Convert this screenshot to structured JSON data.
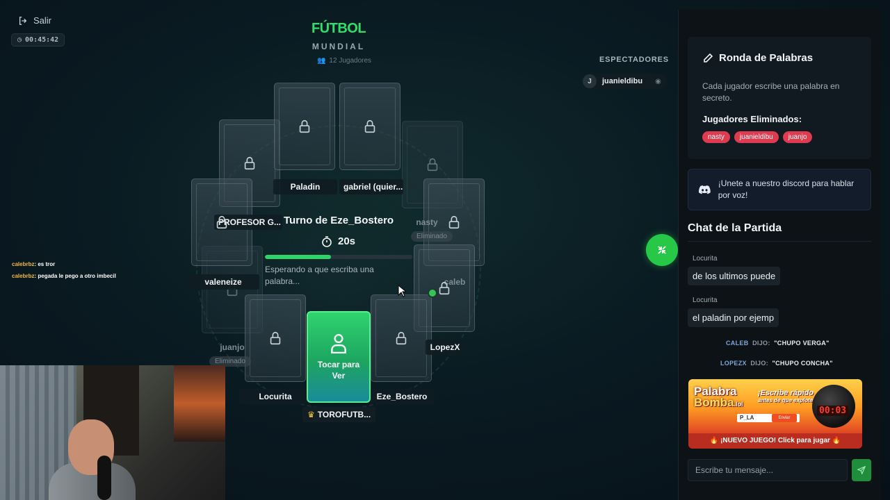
{
  "header": {
    "exit_label": "Salir",
    "session_timer": "00:45:42",
    "game_title": "FÚTBOL",
    "game_subtitle": "MUNDIAL",
    "players_count": "12 Jugadores"
  },
  "board": {
    "players": [
      {
        "name": "Paladin",
        "eliminated": false
      },
      {
        "name": "gabriel (quier...",
        "eliminated": false
      },
      {
        "name": "PROFESOR G...",
        "eliminated": false
      },
      {
        "name": "nasty",
        "eliminated": true
      },
      {
        "name": "valeneize",
        "eliminated": false
      },
      {
        "name": "caleb",
        "eliminated": false
      },
      {
        "name": "juanjo",
        "eliminated": true
      },
      {
        "name": "LopezX",
        "eliminated": false
      },
      {
        "name": "Locurita",
        "eliminated": false
      },
      {
        "name": "Eze_Bostero",
        "eliminated": false
      }
    ],
    "eliminated_label": "Eliminado",
    "center_card_label": "Tocar para Ver",
    "host_name": "TOROFUTB...",
    "turn_text": "Turno de Eze_Bostero",
    "turn_timer": "20s",
    "turn_progress": 0.45,
    "waiting_text": "Esperando a que escriba una palabra..."
  },
  "spectators": {
    "title": "ESPECTADORES",
    "items": [
      {
        "initial": "J",
        "name": "juanieldibu"
      }
    ]
  },
  "stream_chat": [
    {
      "user": "calebrbz",
      "text": ": es tror"
    },
    {
      "user": "calebrbz",
      "text": ": pegada le pego a otro imbecil"
    }
  ],
  "round": {
    "title": "Ronda de Palabras",
    "description": "Cada jugador escribe una palabra en secreto.",
    "eliminated_title": "Jugadores Eliminados:",
    "eliminated": [
      "nasty",
      "juanieldibu",
      "juanjo"
    ]
  },
  "discord": {
    "text": "¡Unete a nuestro discord para hablar por voz!"
  },
  "chat": {
    "title": "Chat de la Partida",
    "messages": [
      {
        "author": "Locurita",
        "text": "de los ultimos puede"
      },
      {
        "author": "Locurita",
        "text": "el paladin por ejemp"
      }
    ],
    "system": [
      {
        "user": "CALEB",
        "dijo": "DIJO:",
        "quote": "\"CHUPO VERGA\""
      },
      {
        "user": "LOPEZX",
        "dijo": "DIJO:",
        "quote": "\"CHUPO CONCHA\""
      }
    ],
    "input_placeholder": "Escribe tu mensaje..."
  },
  "ad": {
    "logo_line1": "Palabra",
    "logo_line2": "Bomba",
    "logo_suffix": ".lol",
    "tagline": "¡Escribe rápido",
    "tagline_small": "antes de que explote!",
    "clock": "00:03",
    "field_text": "P_LA",
    "send_text": "Enviar",
    "cta": "🔥 ¡NUEVO JUEGO! Click para jugar 🔥"
  },
  "colors": {
    "accent": "#2ee06b",
    "danger": "#dd3b50",
    "background": "#0a1b22"
  }
}
